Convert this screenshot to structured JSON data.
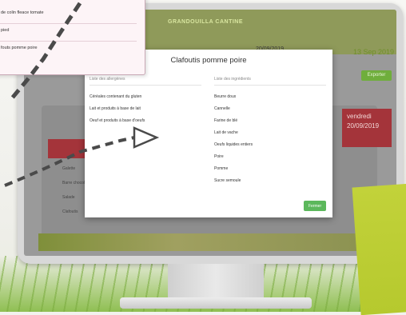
{
  "app_background": {
    "logo": "GRANDOUILLA CANTINE",
    "date_text": "20/09/2019",
    "date_highlight": "13 Sep 2019",
    "button_label": "Exporter",
    "day_card": "vendredi\n20/09/2019",
    "row_labels": [
      "Galette",
      "Barre chocolat",
      "Salade",
      "Clafoutis"
    ]
  },
  "callout": {
    "lines": [
      "de colin fleace tomate",
      "pied",
      "fouts pomme poire"
    ]
  },
  "modal": {
    "title": "Clafoutis pomme poire",
    "left_header": "Liste des allergènes",
    "right_header": "Liste des ingrédients",
    "allergens": [
      "Céréales contenant du gluten",
      "Lait et produits à base de lait",
      "Oeuf et produits à base d'oeufs"
    ],
    "ingredients": [
      "Beurre doux",
      "Cannelle",
      "Farine de blé",
      "Lait de vache",
      "Oeufs liquides entiers",
      "Poire",
      "Pomme",
      "Sucre semoule"
    ],
    "close_label": "Fermer"
  },
  "colors": {
    "accent_green": "#5cb85c",
    "header_red": "#a4343a",
    "booklet_green": "#c2d23a"
  }
}
